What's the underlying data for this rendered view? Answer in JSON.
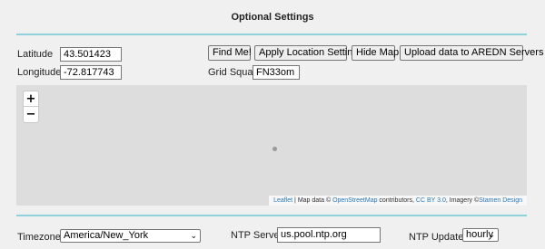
{
  "title": "Optional Settings",
  "location": {
    "latitude_label": "Latitude",
    "latitude_value": "43.501423",
    "longitude_label": "Longitude",
    "longitude_value": "-72.817743",
    "grid_label": "Grid Square",
    "grid_value": "FN33om"
  },
  "buttons": {
    "find_me": "Find Me!",
    "apply": "Apply Location Settings",
    "hide_map": "Hide Map",
    "upload": "Upload data to AREDN Servers"
  },
  "map": {
    "zoom_in": "+",
    "zoom_out": "−",
    "attrib_leaflet": "Leaflet",
    "attrib_sep": " | Map data © ",
    "attrib_osm": "OpenStreetMap",
    "attrib_contrib": " contributors, ",
    "attrib_cc": "CC BY 3.0",
    "attrib_imagery": ", Imagery ©",
    "attrib_stamen": "Stamen Design"
  },
  "time": {
    "timezone_label": "Timezone",
    "timezone_value": "America/New_York",
    "ntp_label": "NTP Server",
    "ntp_value": "us.pool.ntp.org",
    "updates_label": "NTP Updates",
    "updates_value": "hourly"
  },
  "icons": {
    "chevron": "⌄"
  },
  "colors": {
    "rule": "#8ed3db",
    "link": "#2a7ab8"
  }
}
